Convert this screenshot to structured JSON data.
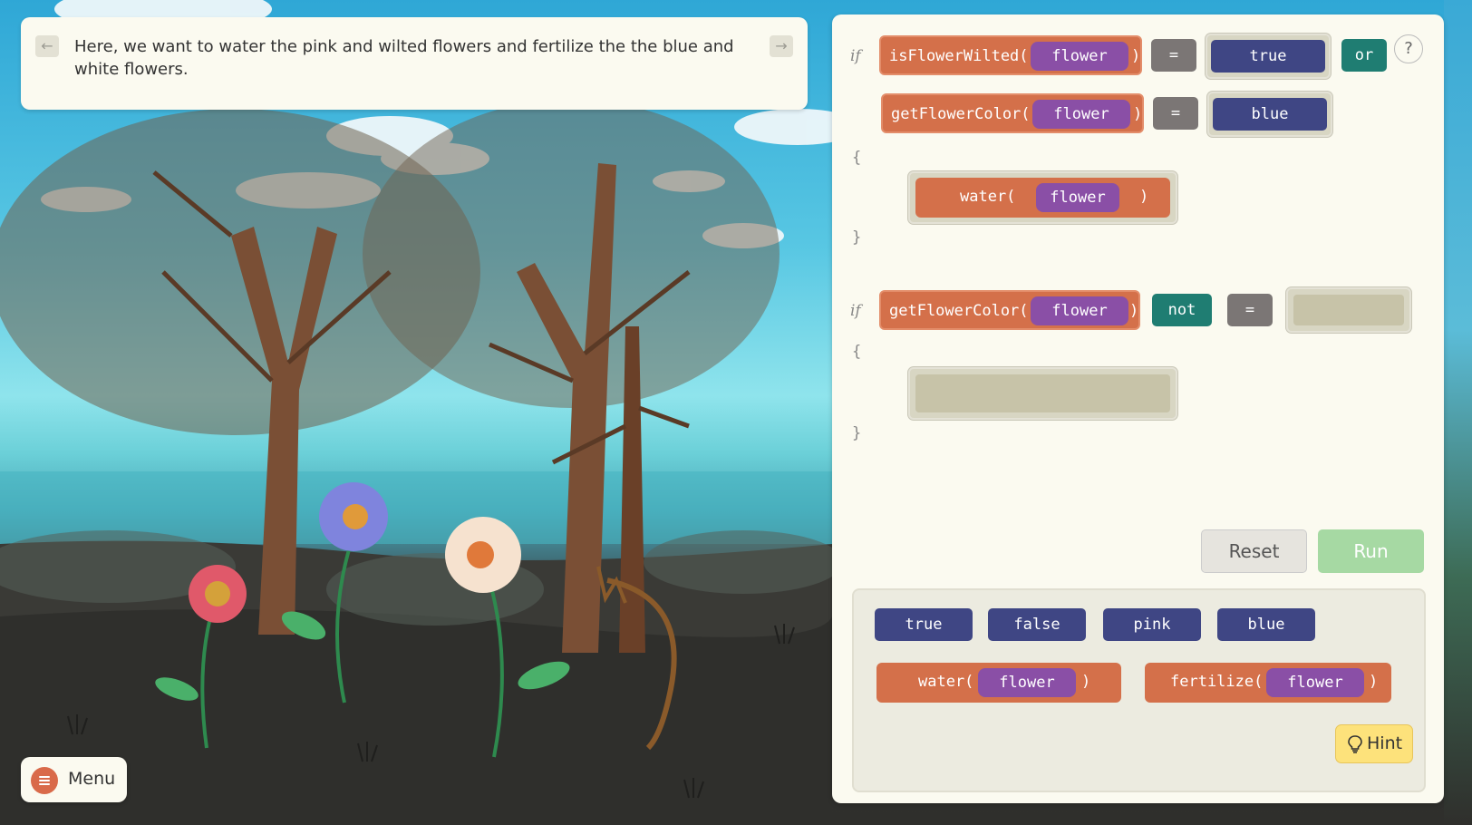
{
  "instruction": {
    "text": "Here, we want to water the pink and wilted flowers and  fertilize the the blue and white flowers.",
    "prev_icon": "arrow-left-icon",
    "next_icon": "arrow-right-icon"
  },
  "menu": {
    "label": "Menu",
    "icon": "hamburger-icon"
  },
  "code": {
    "keyword_if": "if",
    "brace_open": "{",
    "brace_close": "}",
    "block1": {
      "cond1_fn": "isFlowerWilted(",
      "cond1_arg": "flower",
      "close_paren": ")",
      "cond1_op": "=",
      "cond1_val": "true",
      "or_label": "or",
      "cond2_fn": "getFlowerColor(",
      "cond2_arg": "flower",
      "cond2_op": "=",
      "cond2_val": "blue",
      "body_fn": "water(",
      "body_arg": "flower"
    },
    "block2": {
      "cond_fn": "getFlowerColor(",
      "cond_arg": "flower",
      "not_label": "not",
      "cond_op": "="
    }
  },
  "help_label": "?",
  "buttons": {
    "reset": "Reset",
    "run": "Run"
  },
  "palette": {
    "values": [
      "true",
      "false",
      "pink",
      "blue"
    ],
    "water_fn": "water(",
    "water_arg": "flower",
    "fertilize_fn": "fertilize(",
    "fertilize_arg": "flower",
    "close_paren": ")",
    "hint": "Hint"
  },
  "colors": {
    "function_block": "#d4704a",
    "argument_block": "#8a4fa6",
    "value_block": "#3f4684",
    "operator_block": "#7b7675",
    "logic_block": "#1f7d72",
    "run_button": "#a6d9a3",
    "hint_button": "#fde27b"
  }
}
